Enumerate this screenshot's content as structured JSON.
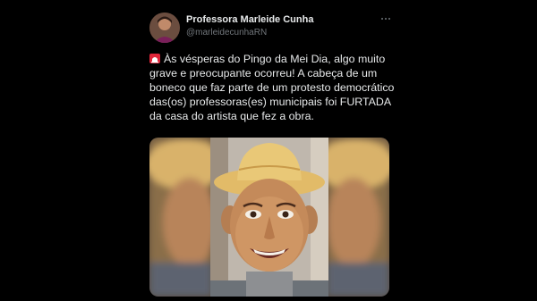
{
  "author": {
    "name": "Professora Marleide Cunha",
    "handle": "@marleidecunhaRN"
  },
  "tweet": {
    "emoji_icon": "police-siren-icon",
    "text": "Às vésperas do Pingo da Mei Dia, algo muito grave e preocupante ocorreu! A cabeça de um boneco que faz parte de um protesto democrático das(os) professoras(es) municipais foi FURTADA da casa do artista que fez a obra."
  },
  "icons": {
    "more": "more-options-icon"
  },
  "colors": {
    "background": "#000000",
    "text": "#e7e9ea",
    "secondary_text": "#71767b",
    "siren_red": "#e0263a"
  }
}
